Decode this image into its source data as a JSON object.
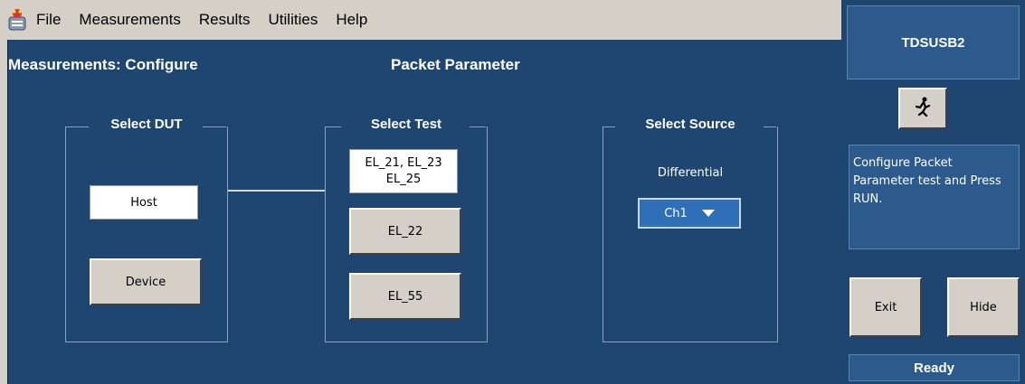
{
  "menu": [
    "File",
    "Measurements",
    "Results",
    "Utilities",
    "Help"
  ],
  "header": {
    "section_title": "Measurements: Configure",
    "test_title": "Packet Parameter"
  },
  "select_dut": {
    "legend": "Select DUT",
    "host_label": "Host",
    "device_label": "Device"
  },
  "select_test": {
    "legend": "Select Test",
    "el21_line1": "EL_21, EL_23",
    "el21_line2": "EL_25",
    "el22_label": "EL_22",
    "el55_label": "EL_55"
  },
  "select_source": {
    "legend": "Select Source",
    "mode_label": "Differential",
    "channel_value": "Ch1"
  },
  "side_panel": {
    "app_name": "TDSUSB2",
    "run_icon": "running-man-icon",
    "info_text": "Configure  Packet Parameter test and Press RUN.",
    "exit_label": "Exit",
    "hide_label": "Hide",
    "status_text": "Ready"
  },
  "colors": {
    "panel_blue": "#1f4670",
    "box_blue": "#2c5a8c",
    "dropdown_blue": "#2e6fb8",
    "button_gray": "#d4d0c8"
  }
}
